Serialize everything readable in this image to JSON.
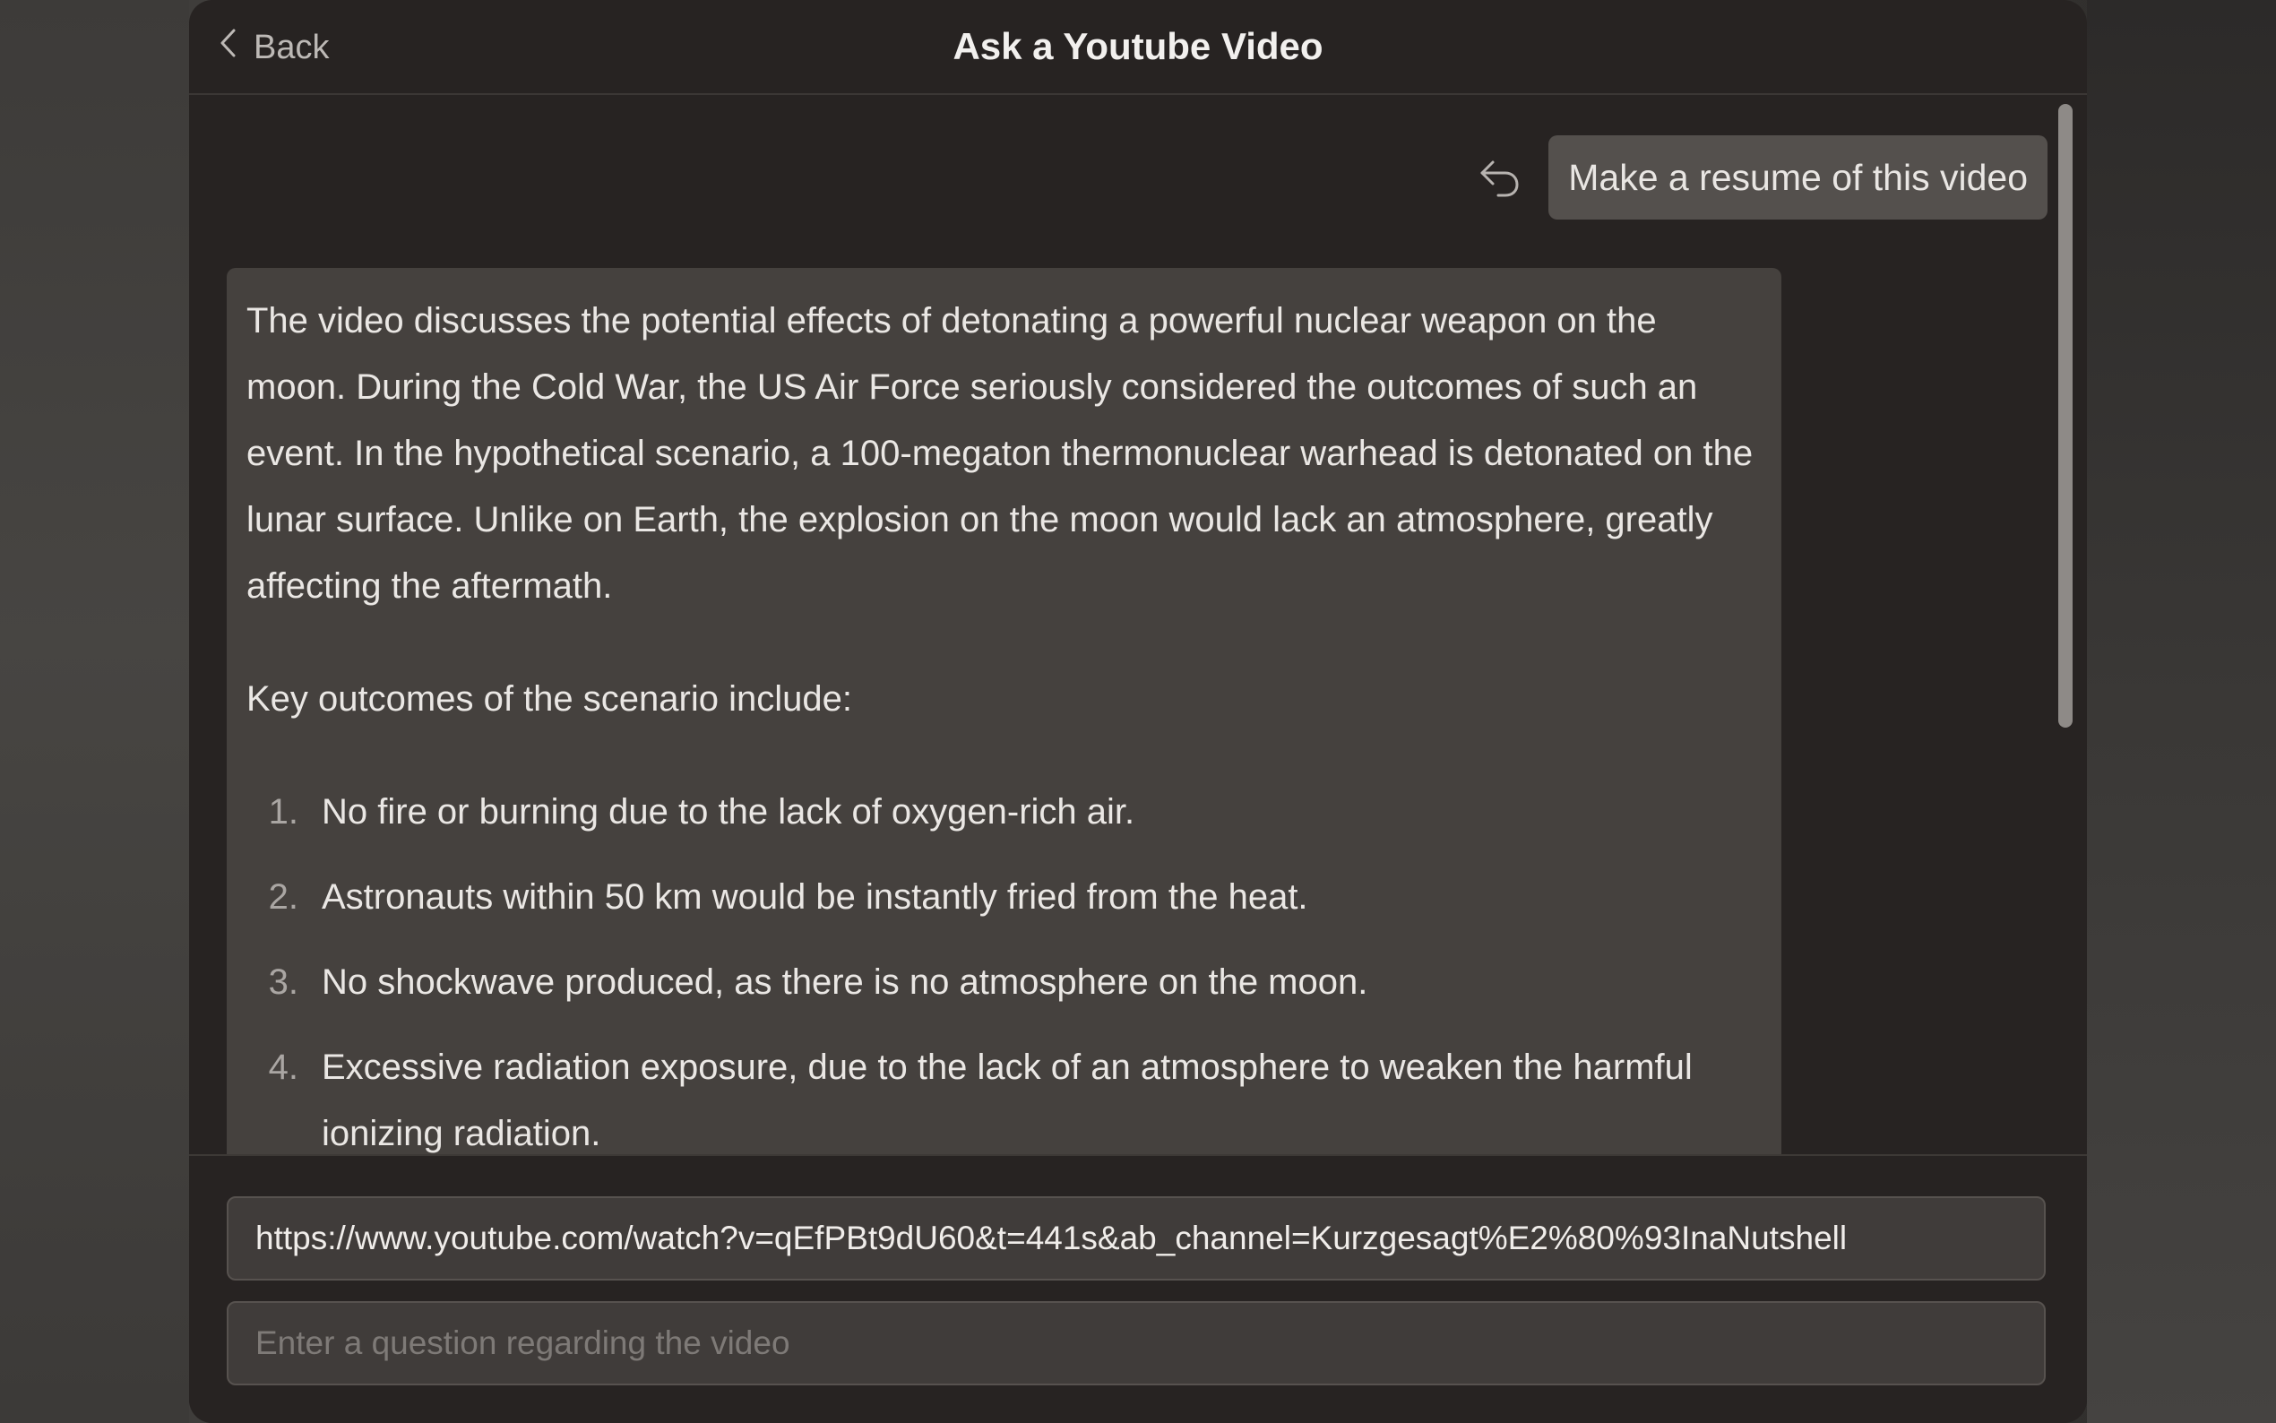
{
  "window": {
    "title": "Ask a Youtube Video",
    "back_label": "Back"
  },
  "user_message": {
    "text": "Make a resume of this video"
  },
  "answer": {
    "paragraph1": "The video discusses the potential effects of detonating a powerful nuclear weapon on the moon. During the Cold War, the US Air Force seriously considered the outcomes of such an event. In the hypothetical scenario, a 100-megaton thermonuclear warhead is detonated on the lunar surface. Unlike on Earth, the explosion on the moon would lack an atmosphere, greatly affecting the aftermath.",
    "paragraph2": "Key outcomes of the scenario include:",
    "items": [
      {
        "num": "1.",
        "text": "No fire or burning due to the lack of oxygen-rich air."
      },
      {
        "num": "2.",
        "text": "Astronauts within 50 km would be instantly fried from the heat."
      },
      {
        "num": "3.",
        "text": "No shockwave produced, as there is no atmosphere on the moon."
      },
      {
        "num": "4.",
        "text": "Excessive radiation exposure, due to the lack of an atmosphere to weaken the harmful ionizing radiation."
      }
    ]
  },
  "inputs": {
    "url_value": "https://www.youtube.com/watch?v=qEfPBt9dU60&t=441s&ab_channel=Kurzgesagt%E2%80%93InaNutshell",
    "question_placeholder": "Enter a question regarding the video"
  },
  "icons": {
    "back": "chevron-left-icon",
    "undo": "undo-arrow-icon"
  }
}
